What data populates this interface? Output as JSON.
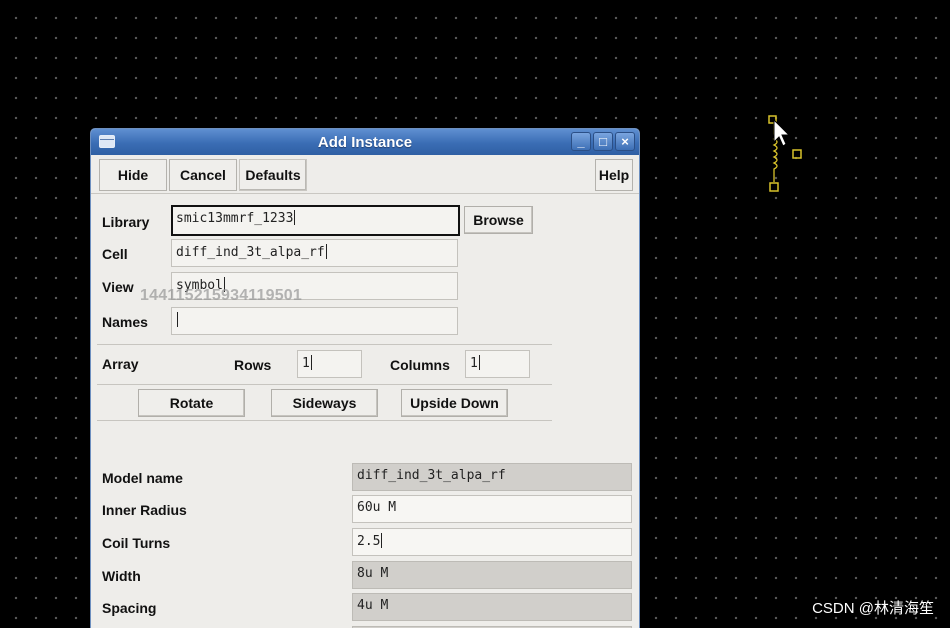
{
  "dialog": {
    "title": "Add Instance",
    "buttons": {
      "hide": "Hide",
      "cancel": "Cancel",
      "defaults": "Defaults",
      "help": "Help",
      "browse": "Browse"
    },
    "window_controls": {
      "minimize": "_",
      "maximize": "□",
      "close": "×"
    },
    "library": {
      "label": "Library",
      "value": "smic13mmrf_1233"
    },
    "cell": {
      "label": "Cell",
      "value": "diff_ind_3t_alpa_rf"
    },
    "view": {
      "label": "View",
      "value": "symbol"
    },
    "names": {
      "label": "Names",
      "value": ""
    },
    "array": {
      "label": "Array",
      "rows_label": "Rows",
      "rows_value": "1",
      "columns_label": "Columns",
      "columns_value": "1"
    },
    "orientation": {
      "rotate": "Rotate",
      "sideways": "Sideways",
      "upside_down": "Upside Down"
    },
    "params": [
      {
        "label": "Model name",
        "value": "diff_ind_3t_alpa_rf"
      },
      {
        "label": "Inner Radius",
        "value": "60u M"
      },
      {
        "label": "Coil Turns",
        "value": "2.5"
      },
      {
        "label": "Width",
        "value": "8u M"
      },
      {
        "label": "Spacing",
        "value": "4u M"
      }
    ]
  },
  "watermark": "1441152159341195​01",
  "csdn_credit": "CSDN @林清海笙",
  "colors": {
    "titlebar": "#3a6db4",
    "symbol": "#d8c22a",
    "background": "#000000"
  },
  "icons": [
    "window-menu-icon",
    "minimize-icon",
    "maximize-icon",
    "close-icon",
    "inductor-symbol-icon",
    "mouse-cursor-icon"
  ]
}
